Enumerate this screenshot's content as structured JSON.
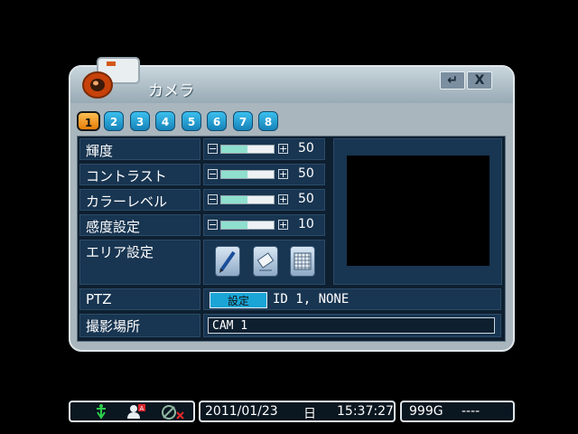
{
  "dialog": {
    "title": "カメラ",
    "enter_icon": "↵",
    "close_label": "X"
  },
  "tabs": [
    {
      "label": "1",
      "active": true
    },
    {
      "label": "2"
    },
    {
      "label": "3"
    },
    {
      "label": "4"
    },
    {
      "label": "5"
    },
    {
      "label": "6"
    },
    {
      "label": "7"
    },
    {
      "label": "8"
    }
  ],
  "settings": {
    "brightness": {
      "label": "輝度",
      "value": "50",
      "level": 0.5
    },
    "contrast": {
      "label": "コントラスト",
      "value": "50",
      "level": 0.5
    },
    "color": {
      "label": "カラーレベル",
      "value": "50",
      "level": 0.5
    },
    "sensitivity": {
      "label": "感度設定",
      "value": "10",
      "level": 0.5
    },
    "area": {
      "label": "エリア設定"
    },
    "ptz": {
      "label": "PTZ",
      "button": "設定",
      "status": "ID 1, NONE"
    },
    "location": {
      "label": "撮影場所",
      "value": "CAM  1"
    }
  },
  "status_bar": {
    "date": "2011/01/23",
    "weekday": "日",
    "time": "15:37:27",
    "disk": "999G",
    "dashes": "----"
  },
  "colors": {
    "accent": "#e57d08",
    "tab": "#1aa5d6"
  }
}
